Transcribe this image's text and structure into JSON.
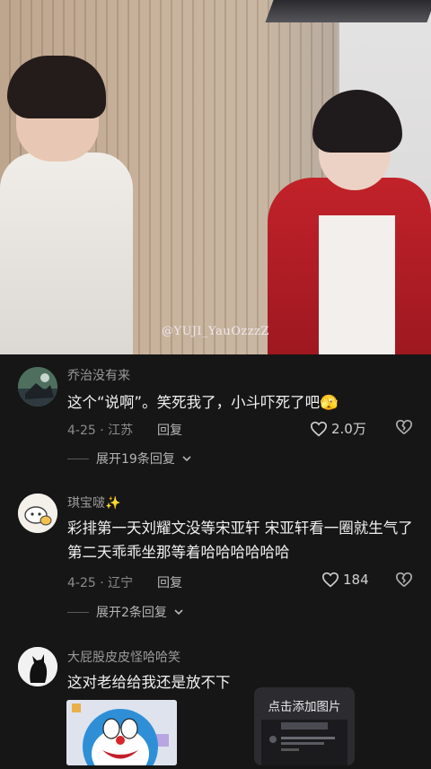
{
  "video": {
    "watermark": "@YUJI_YauOzzzZ"
  },
  "comments": [
    {
      "username": "乔治没有来",
      "text": "这个“说啊”。笑死我了，小斗吓死了吧🫣",
      "date_location": "4-25 · 江苏",
      "reply_label": "回复",
      "likes": "2.0万",
      "expand_label": "展开19条回复"
    },
    {
      "username": "琪宝啵✨",
      "text": "彩排第一天刘耀文没等宋亚轩 宋亚轩看一圈就生气了 第二天乖乖坐那等着哈哈哈哈哈哈",
      "date_location": "4-25 · 辽宁",
      "reply_label": "回复",
      "likes": "184",
      "expand_label": "展开2条回复"
    },
    {
      "username": "大屁股皮皮怪哈哈笑",
      "text": "这对老给给我还是放不下"
    }
  ],
  "add_image": {
    "label": "点击添加图片"
  },
  "icons": {
    "like": "heart-outline-icon",
    "dislike": "broken-heart-icon",
    "expand": "chevron-down-icon"
  },
  "colors": {
    "background": "#161616",
    "text_primary": "#f0f0f0",
    "text_secondary": "#8c8c8c"
  }
}
